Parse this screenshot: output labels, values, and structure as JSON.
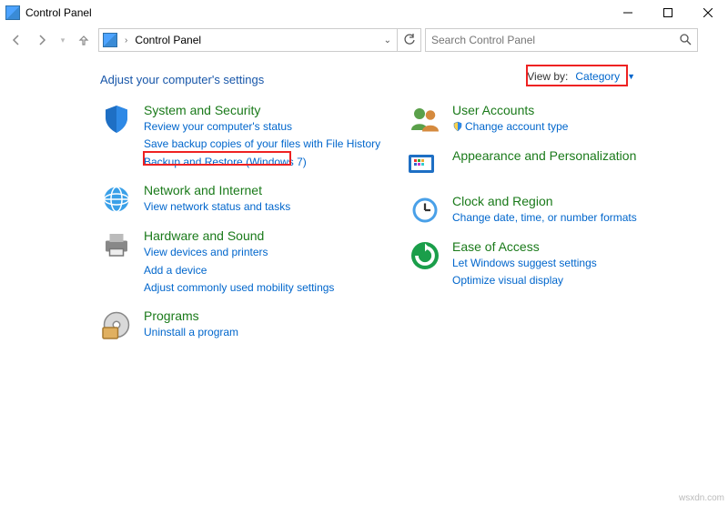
{
  "window": {
    "title": "Control Panel"
  },
  "address": {
    "crumb": "Control Panel"
  },
  "search": {
    "placeholder": "Search Control Panel"
  },
  "heading": "Adjust your computer's settings",
  "viewby": {
    "label": "View by:",
    "value": "Category"
  },
  "left": [
    {
      "title": "System and Security",
      "subs": [
        "Review your computer's status",
        "Save backup copies of your files with File History",
        "Backup and Restore (Windows 7)"
      ]
    },
    {
      "title": "Network and Internet",
      "subs": [
        "View network status and tasks"
      ]
    },
    {
      "title": "Hardware and Sound",
      "subs": [
        "View devices and printers",
        "Add a device",
        "Adjust commonly used mobility settings"
      ]
    },
    {
      "title": "Programs",
      "subs": [
        "Uninstall a program"
      ]
    }
  ],
  "right": [
    {
      "title": "User Accounts",
      "subs": [
        "Change account type"
      ]
    },
    {
      "title": "Appearance and Personalization",
      "subs": []
    },
    {
      "title": "Clock and Region",
      "subs": [
        "Change date, time, or number formats"
      ]
    },
    {
      "title": "Ease of Access",
      "subs": [
        "Let Windows suggest settings",
        "Optimize visual display"
      ]
    }
  ],
  "attribution": "wsxdn.com"
}
